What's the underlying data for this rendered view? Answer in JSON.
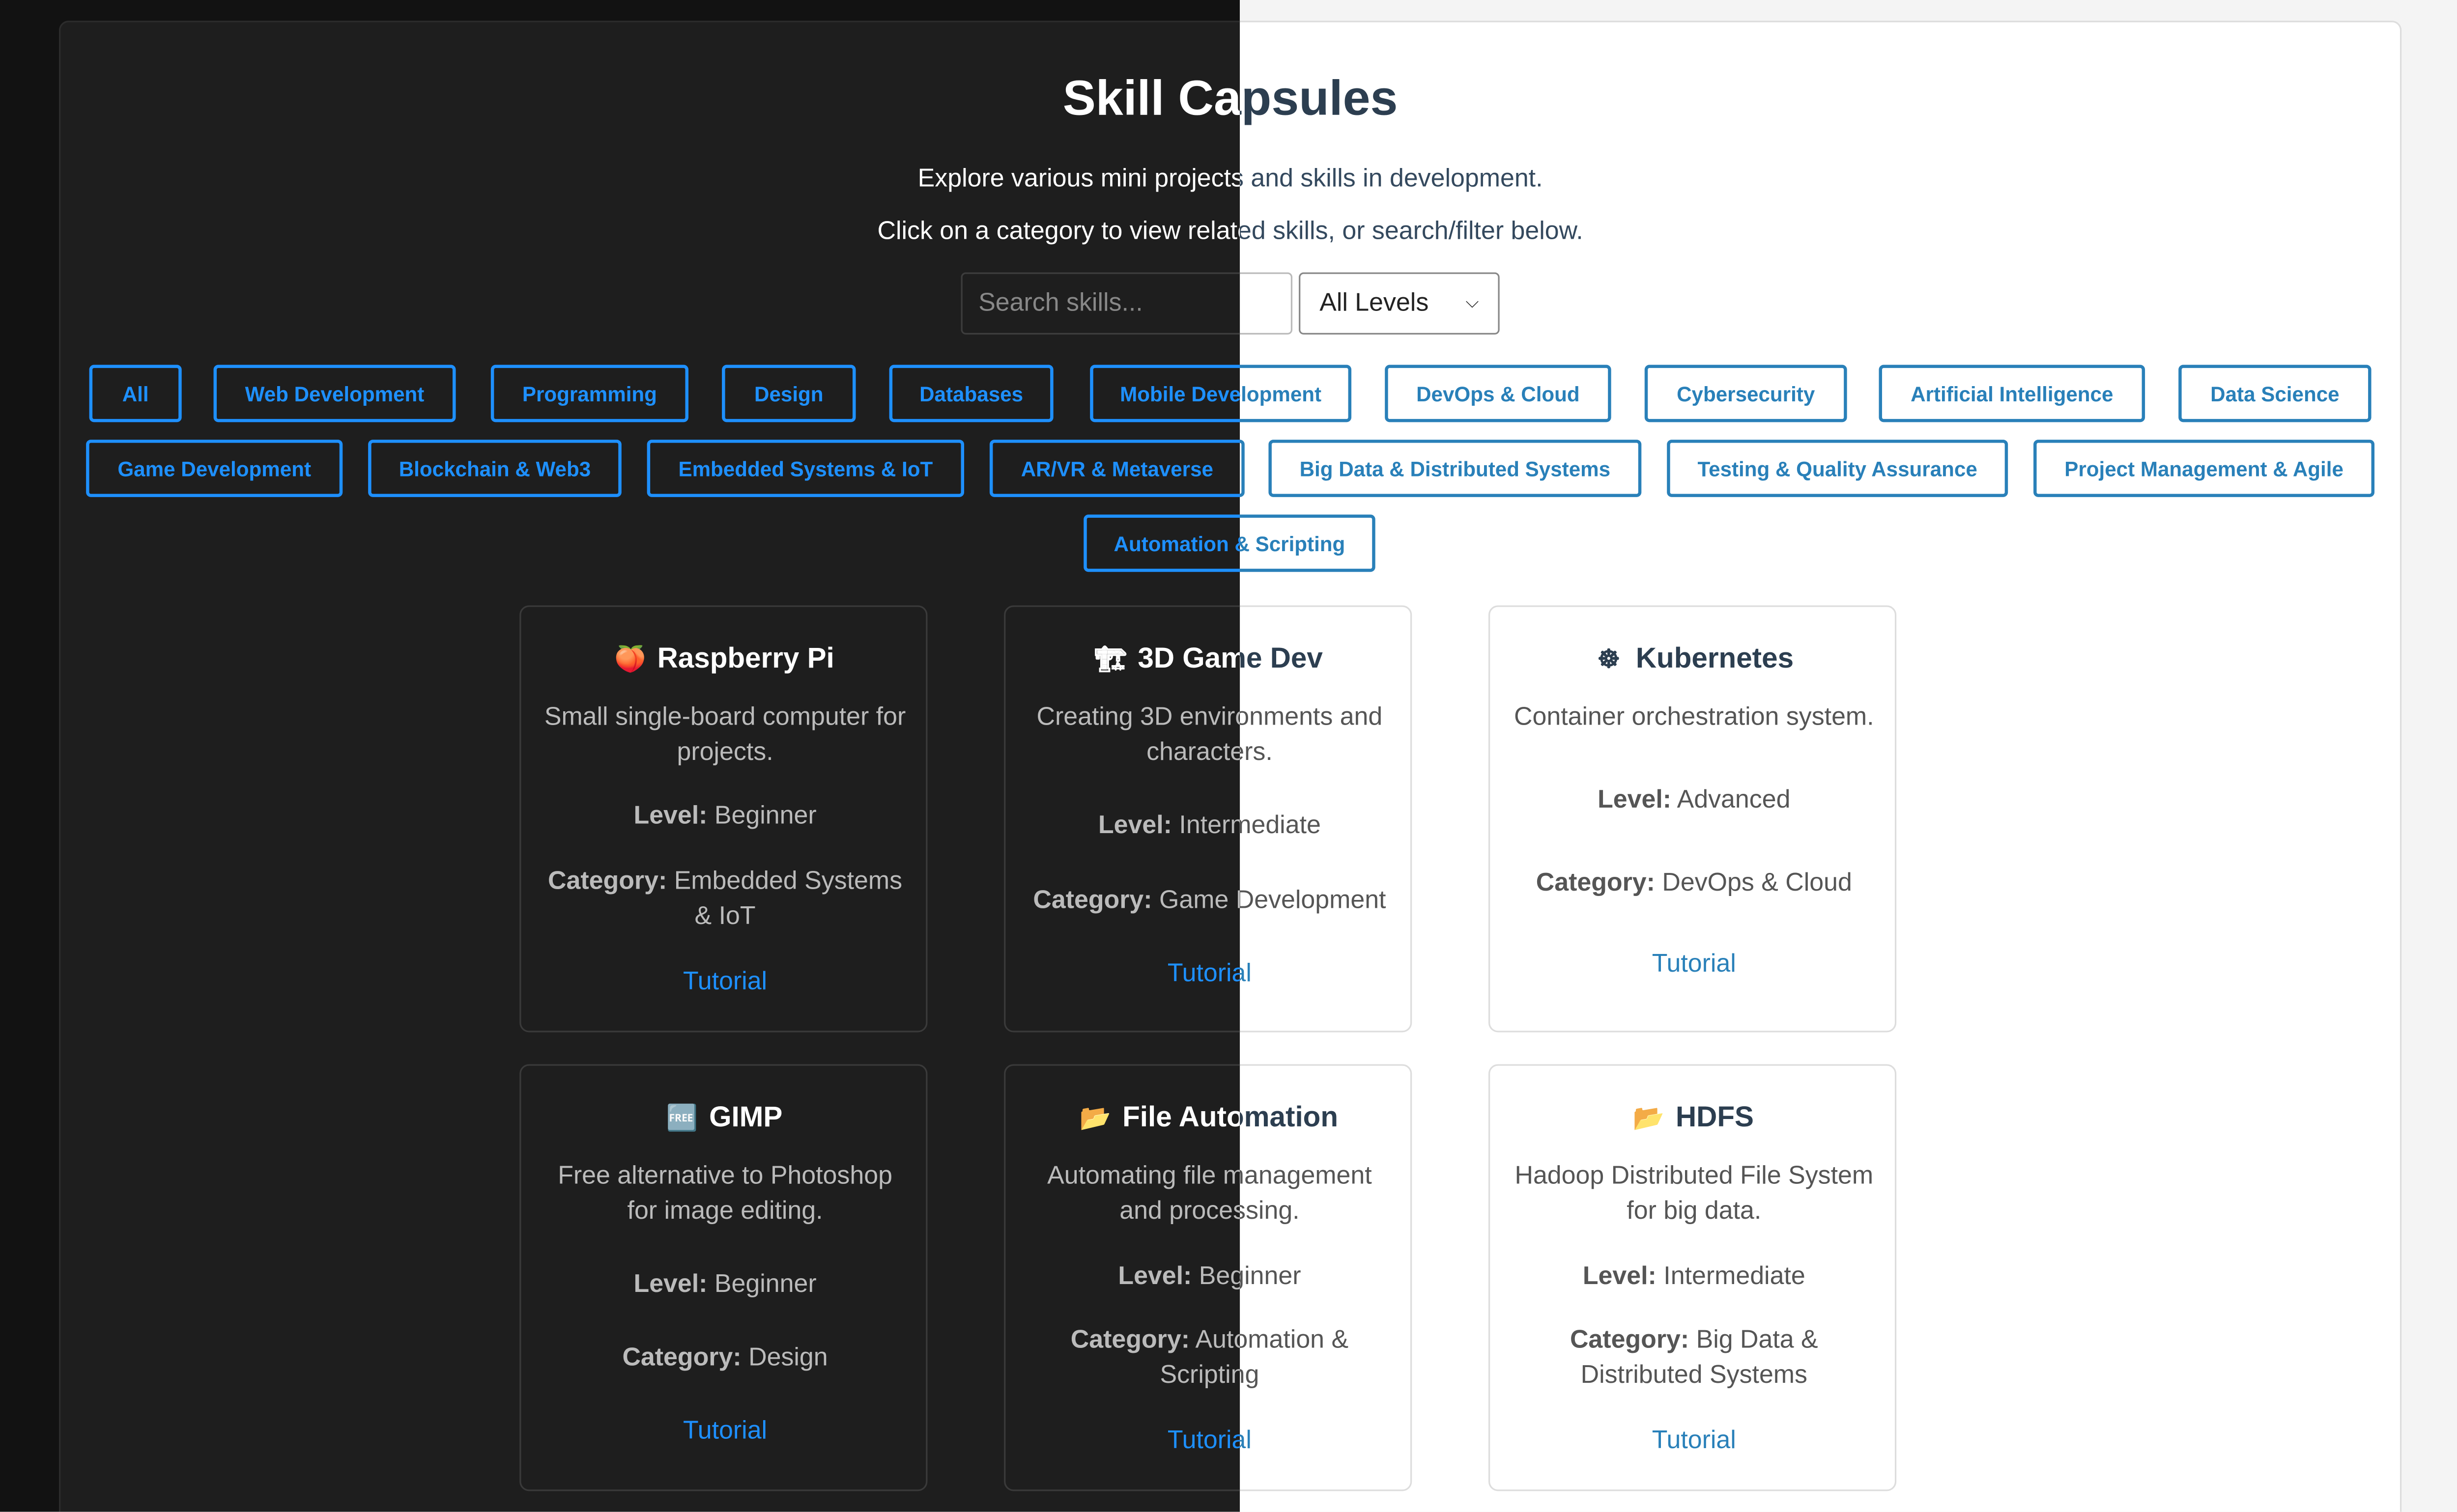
{
  "header": {
    "title": "Skill Capsules",
    "subtitle1": "Explore various mini projects and skills in development.",
    "subtitle2": "Click on a category to view related skills, or search/filter below."
  },
  "search": {
    "placeholder": "Search skills...",
    "value": ""
  },
  "level_filter": {
    "selected": "All Levels"
  },
  "categories": [
    "All",
    "Web Development",
    "Programming",
    "Design",
    "Databases",
    "Mobile Development",
    "DevOps & Cloud",
    "Cybersecurity",
    "Artificial Intelligence",
    "Data Science",
    "Game Development",
    "Blockchain & Web3",
    "Embedded Systems & IoT",
    "AR/VR & Metaverse",
    "Big Data & Distributed Systems",
    "Testing & Quality Assurance",
    "Project Management & Agile",
    "Automation & Scripting"
  ],
  "labels": {
    "level": "Level:",
    "category": "Category:"
  },
  "cards": [
    {
      "icon": "🍑",
      "icon_name": "peach-icon",
      "title": "Raspberry Pi",
      "description": "Small single-board computer for projects.",
      "level": "Beginner",
      "category": "Embedded Systems & IoT",
      "link": "Tutorial"
    },
    {
      "icon": "🏗",
      "icon_name": "construction-crane-icon",
      "title": "3D Game Dev",
      "description": "Creating 3D environments and characters.",
      "level": "Intermediate",
      "category": "Game Development",
      "link": "Tutorial"
    },
    {
      "icon": "☸",
      "icon_name": "helm-wheel-icon",
      "title": "Kubernetes",
      "description": "Container orchestration system.",
      "level": "Advanced",
      "category": "DevOps & Cloud",
      "link": "Tutorial"
    },
    {
      "icon": "🆓",
      "icon_name": "free-badge-icon",
      "title": "GIMP",
      "description": "Free alternative to Photoshop for image editing.",
      "level": "Beginner",
      "category": "Design",
      "link": "Tutorial"
    },
    {
      "icon": "📂",
      "icon_name": "folder-icon",
      "title": "File Automation",
      "description": "Automating file management and processing.",
      "level": "Beginner",
      "category": "Automation & Scripting",
      "link": "Tutorial"
    },
    {
      "icon": "📂",
      "icon_name": "folder-icon",
      "title": "HDFS",
      "description": "Hadoop Distributed File System for big data.",
      "level": "Intermediate",
      "category": "Big Data & Distributed Systems",
      "link": "Tutorial"
    }
  ]
}
